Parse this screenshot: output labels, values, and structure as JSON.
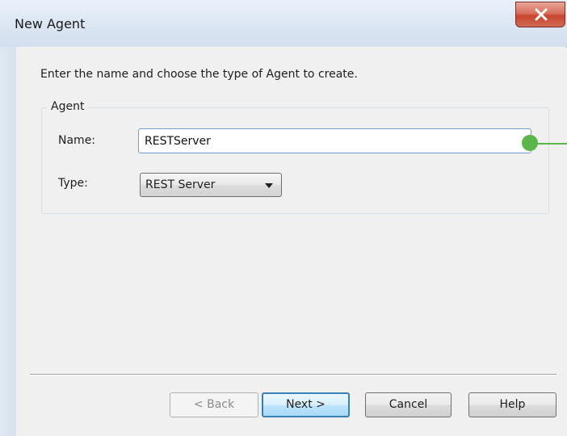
{
  "window": {
    "title": "New Agent",
    "close_glyph": "x"
  },
  "dialog": {
    "instruction": "Enter the name and choose the type of Agent to create.",
    "group_label": "Agent",
    "name_label": "Name:",
    "name_value": "RESTServer",
    "type_label": "Type:",
    "type_value": "REST Server",
    "annotation_color": "#5cb54a"
  },
  "buttons": {
    "back": "< Back",
    "next": "Next >",
    "cancel": "Cancel",
    "help": "Help"
  }
}
